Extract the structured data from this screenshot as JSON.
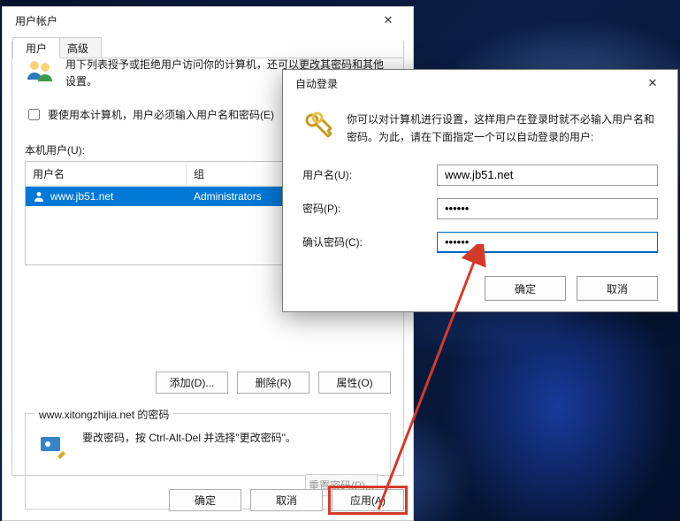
{
  "main": {
    "title": "用户帐户",
    "tabs": {
      "users": "用户",
      "advanced": "高级"
    },
    "intro": "用下列表授予或拒绝用户访问你的计算机，还可以更改其密码和其他设置。",
    "checkbox_label": "要使用本计算机，用户必须输入用户名和密码(E)",
    "local_users_label": "本机用户(U):",
    "table": {
      "col_name": "用户名",
      "col_group": "组",
      "rows": [
        {
          "name": "www.jb51.net",
          "group": "Administrators"
        }
      ]
    },
    "btns": {
      "add": "添加(D)...",
      "remove": "删除(R)",
      "props": "属性(O)"
    },
    "password_group": {
      "legend": "www.xitongzhijia.net 的密码",
      "text": "要改密码，按 Ctrl-Alt-Del 并选择\"更改密码\"。",
      "reset": "重置密码(P)..."
    },
    "footer": {
      "ok": "确定",
      "cancel": "取消",
      "apply": "应用(A)"
    }
  },
  "dialog": {
    "title": "自动登录",
    "intro": "你可以对计算机进行设置，这样用户在登录时就不必输入用户名和密码。为此，请在下面指定一个可以自动登录的用户:",
    "fields": {
      "username_label": "用户名(U):",
      "username_value": "www.jb51.net",
      "password_label": "密码(P):",
      "password_value": "••••••",
      "confirm_label": "确认密码(C):",
      "confirm_value": "••••••"
    },
    "buttons": {
      "ok": "确定",
      "cancel": "取消"
    }
  }
}
